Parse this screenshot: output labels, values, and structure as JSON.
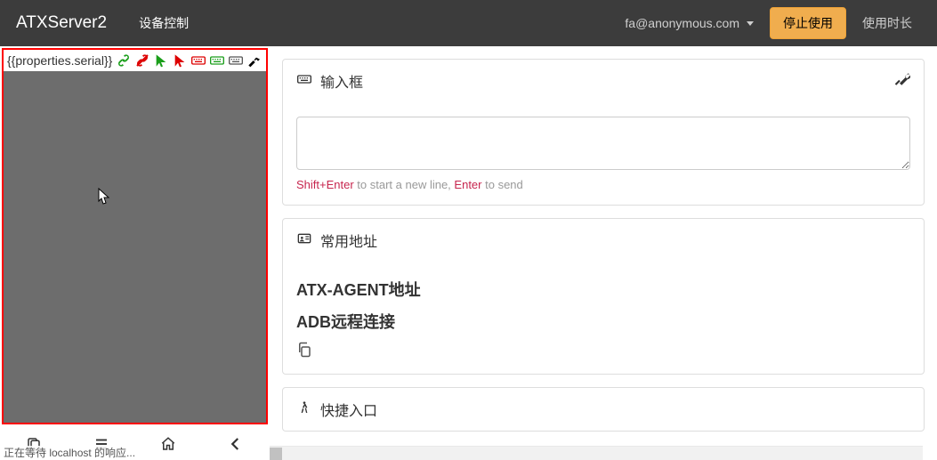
{
  "navbar": {
    "brand": "ATXServer2",
    "device_control": "设备控制",
    "user_email": "fa@anonymous.com",
    "stop_using": "停止使用",
    "usage_duration": "使用时长"
  },
  "device": {
    "serial_placeholder": "{{properties.serial}}"
  },
  "panels": {
    "input_box_title": "输入框",
    "input_help_prefix": "Shift+Enter",
    "input_help_mid": " to start a new line, ",
    "input_help_enter": "Enter",
    "input_help_suffix": " to send",
    "common_addr_title": "常用地址",
    "atx_agent_label": "ATX-AGENT地址",
    "adb_remote_label": "ADB远程连接",
    "quick_entry_title": "快捷入口"
  },
  "status": "正在等待 localhost 的响应..."
}
